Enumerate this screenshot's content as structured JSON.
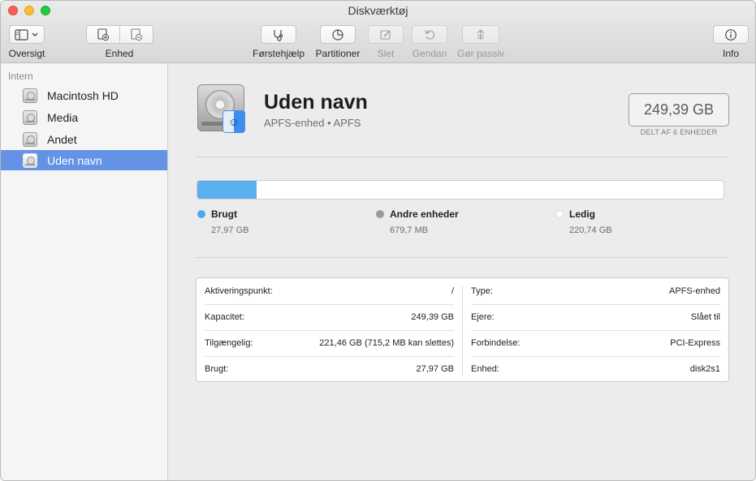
{
  "window": {
    "title": "Diskværktøj"
  },
  "toolbar": {
    "oversigt_label": "Oversigt",
    "enhed_label": "Enhed",
    "forstehjaelp_label": "Førstehjælp",
    "partitioner_label": "Partitioner",
    "slet_label": "Slet",
    "gendan_label": "Gendan",
    "gor_passiv_label": "Gør passiv",
    "info_label": "Info"
  },
  "sidebar": {
    "section": "Intern",
    "items": [
      {
        "label": "Macintosh HD"
      },
      {
        "label": "Media"
      },
      {
        "label": "Andet"
      },
      {
        "label": "Uden navn"
      }
    ]
  },
  "volume": {
    "name": "Uden navn",
    "subtitle": "APFS-enhed • APFS",
    "capacity": "249,39 GB",
    "capacity_note": "DELT AF 6 ENHEDER"
  },
  "usage": {
    "used_fraction": 0.112,
    "legend": [
      {
        "name": "Brugt",
        "value": "27,97 GB",
        "color": "#4da9ec"
      },
      {
        "name": "Andre enheder",
        "value": "679,7 MB",
        "color": "#9b9b9b"
      },
      {
        "name": "Ledig",
        "value": "220,74 GB",
        "color": "#ffffff"
      }
    ]
  },
  "info": {
    "left": [
      {
        "key": "Aktiveringspunkt:",
        "value": "/"
      },
      {
        "key": "Kapacitet:",
        "value": "249,39 GB"
      },
      {
        "key": "Tilgængelig:",
        "value": "221,46 GB (715,2 MB kan slettes)"
      },
      {
        "key": "Brugt:",
        "value": "27,97 GB"
      }
    ],
    "right": [
      {
        "key": "Type:",
        "value": "APFS-enhed"
      },
      {
        "key": "Ejere:",
        "value": "Slået til"
      },
      {
        "key": "Forbindelse:",
        "value": "PCI-Express"
      },
      {
        "key": "Enhed:",
        "value": "disk2s1"
      }
    ]
  }
}
